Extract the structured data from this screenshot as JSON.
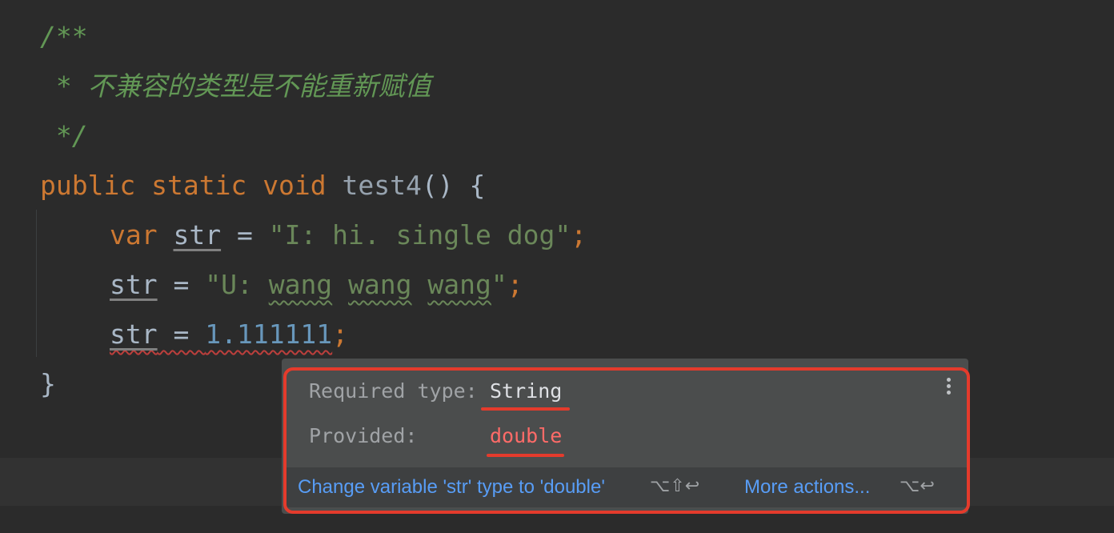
{
  "editor": {
    "comment": {
      "open": "/**",
      "body": " * 不兼容的类型是不能重新赋值",
      "close": " */"
    },
    "method": {
      "mod1": "public",
      "mod2": "static",
      "ret": "void",
      "name": "test4",
      "parens": "()",
      "brace_open": "{",
      "brace_close": "}"
    },
    "line1": {
      "kw": "var",
      "var": "str",
      "eq": " = ",
      "value": "\"I: hi. single dog\"",
      "semi": ";"
    },
    "line2": {
      "var": "str",
      "eq": " = ",
      "q_open": "\"U: ",
      "w1": "wang",
      "sp1": " ",
      "w2": "wang",
      "sp2": " ",
      "w3": "wang",
      "q_close": "\"",
      "semi": ";"
    },
    "line3": {
      "var": "str",
      "eq": " = ",
      "value": "1.111111",
      "semi": ";"
    }
  },
  "popup": {
    "required_label": "Required type:",
    "required_value": "String",
    "provided_label": "Provided:",
    "provided_value": "double",
    "fix_action": "Change variable 'str' type to 'double'",
    "fix_shortcut": "⌥⇧↩",
    "more_actions": "More actions...",
    "more_shortcut": "⌥↩"
  },
  "colors": {
    "background": "#2b2b2b",
    "keyword": "#cc7832",
    "string": "#6a8759",
    "number": "#6897bb",
    "comment": "#629755",
    "error": "#e43b2c",
    "link": "#589df6"
  }
}
